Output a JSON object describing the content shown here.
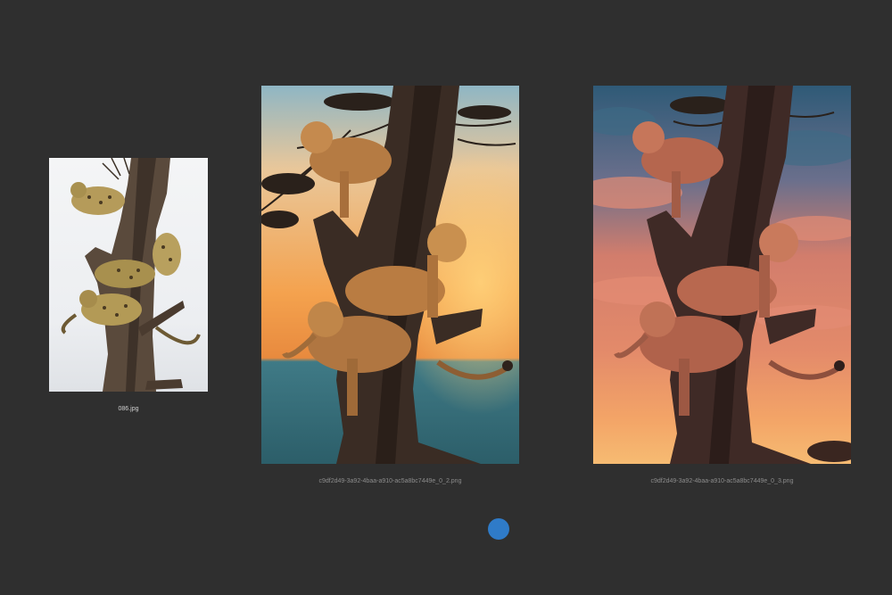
{
  "gallery": {
    "items": [
      {
        "filename": "086.jpg",
        "subject": "leopards-in-tree"
      },
      {
        "filename": "c9df2d49-3a92-4baa-a910-ac5a8bc7449e_0_2.png",
        "subject": "lionesses-in-tree-sunset"
      },
      {
        "filename": "c9df2d49-3a92-4baa-a910-ac5a8bc7449e_0_3.png",
        "subject": "lionesses-in-tree-cloudy-sunset"
      }
    ],
    "pagination": {
      "active_page": 1,
      "total_pages": 1
    }
  },
  "colors": {
    "background": "#2f2f2f",
    "active_dot": "#2f7bc8",
    "caption": "#b9b9b9"
  }
}
